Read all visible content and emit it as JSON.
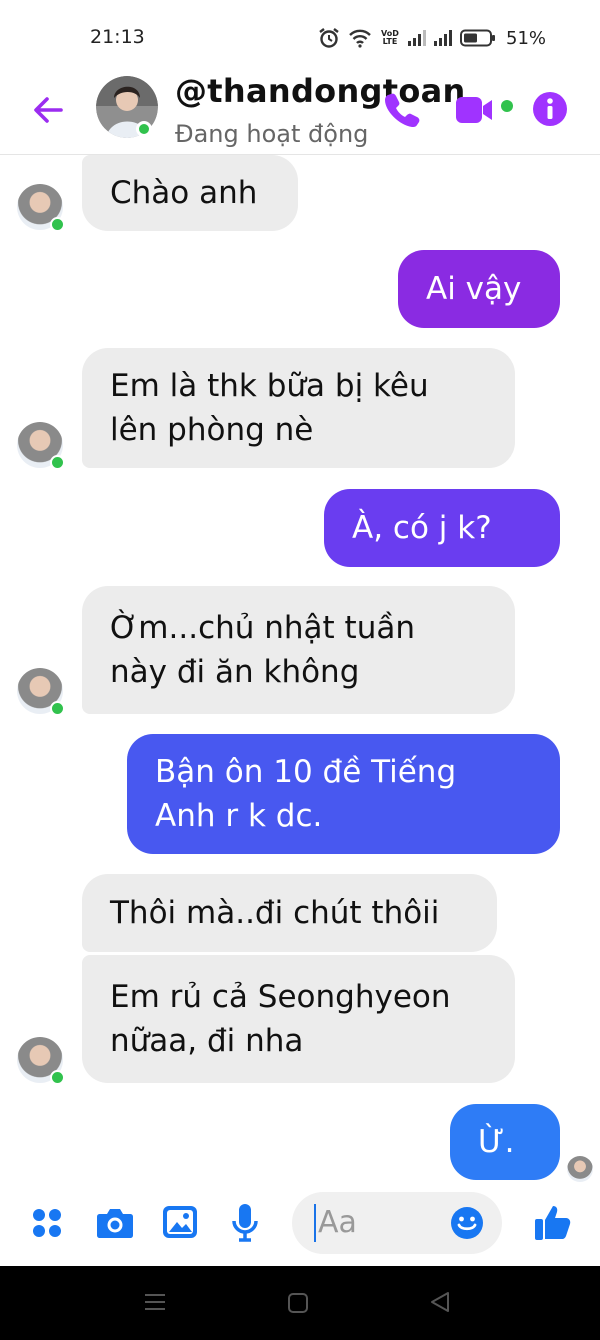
{
  "status_bar": {
    "time": "21:13",
    "network_label": "VoD LTE",
    "battery": "51%"
  },
  "header": {
    "contact_name": "@thandongtoan",
    "contact_status": "Đang hoạt động",
    "icons": [
      "back-arrow-icon",
      "phone-icon",
      "video-camera-icon",
      "info-icon"
    ]
  },
  "messages": [
    {
      "from": "them",
      "text": "Chào anh"
    },
    {
      "from": "me",
      "text": "Ai vậy"
    },
    {
      "from": "them",
      "text": "Em là thk bữa bị kêu\nlên phòng nè"
    },
    {
      "from": "me",
      "text": "À, có j k?"
    },
    {
      "from": "them",
      "text": "Ờm...chủ nhật tuần\nnày đi ăn không"
    },
    {
      "from": "me",
      "text": "Bận ôn 10 đề Tiếng\nAnh r k dc."
    },
    {
      "from": "them",
      "text": "Thôi mà..đi chút thôii"
    },
    {
      "from": "them",
      "text": "Em rủ cả Seonghyeon\nnữaa, đi nha"
    },
    {
      "from": "me",
      "text": "Ừ."
    }
  ],
  "composer": {
    "placeholder": "Aa",
    "icons": [
      "menu-grid-icon",
      "camera-icon",
      "image-icon",
      "microphone-icon",
      "emoji-icon",
      "thumbs-up-icon"
    ]
  },
  "colors": {
    "accent": "#a033ff",
    "bubble_purple": "#8a2be2",
    "bubble_indigo": "#6a3df0",
    "bubble_blue": "#4858f0",
    "bubble_light_blue": "#2e7cf6",
    "incoming": "#ececec",
    "composer_blue": "#1877f2"
  }
}
